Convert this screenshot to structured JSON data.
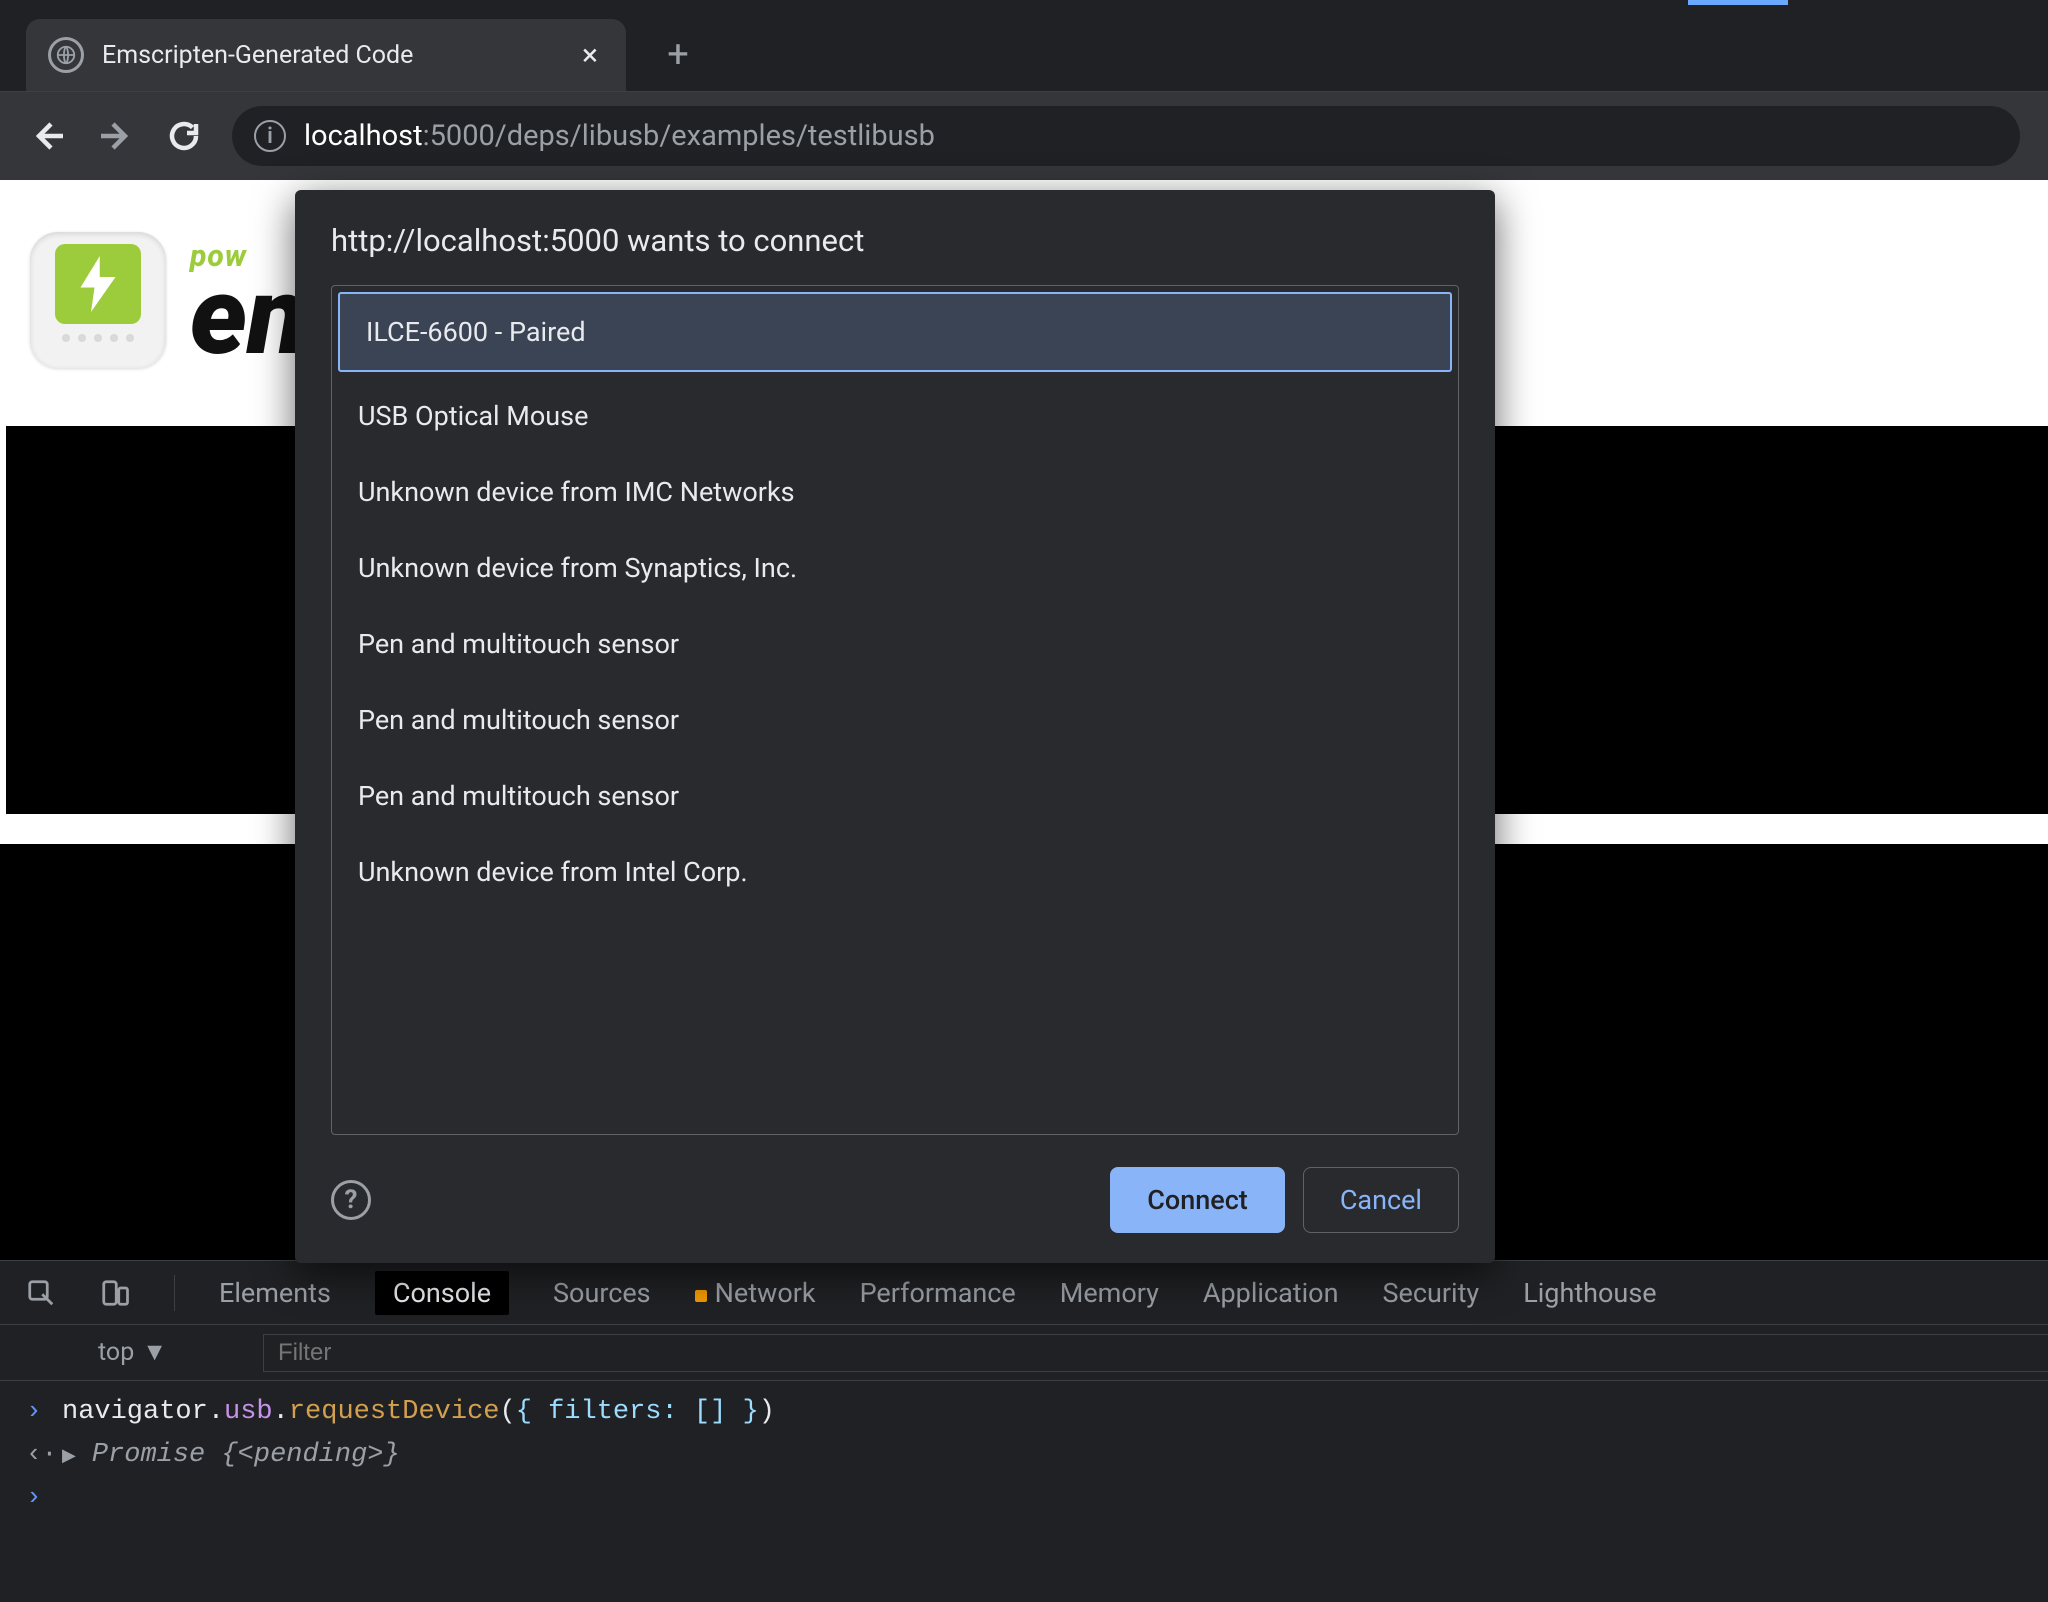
{
  "browser": {
    "tab_title": "Emscripten-Generated Code",
    "url_host": "localhost",
    "url_port_path": ":5000/deps/libusb/examples/testlibusb"
  },
  "page": {
    "brand_pow": "pow",
    "brand_en": "en"
  },
  "dialog": {
    "title": "http://localhost:5000 wants to connect",
    "devices": [
      "ILCE-6600 - Paired",
      "USB Optical Mouse",
      "Unknown device from IMC Networks",
      "Unknown device from Synaptics, Inc.",
      "Pen and multitouch sensor",
      "Pen and multitouch sensor",
      "Pen and multitouch sensor",
      "Unknown device from Intel Corp."
    ],
    "connect_label": "Connect",
    "cancel_label": "Cancel",
    "help_glyph": "?"
  },
  "devtools": {
    "tabs": {
      "elements": "Elements",
      "console": "Console",
      "sources": "Sources",
      "network": "Network",
      "performance": "Performance",
      "memory": "Memory",
      "application": "Application",
      "security": "Security",
      "lighthouse": "Lighthouse"
    },
    "toolbar": {
      "context": "top",
      "filter_placeholder": "Filter"
    },
    "console": {
      "input_tokens": {
        "navigator": "navigator",
        "usb": "usb",
        "requestDevice": "requestDevice",
        "args": "{ filters: [] }"
      },
      "output_tokens": {
        "arrow": "▶",
        "promise": "Promise",
        "open": " {",
        "pending": "<pending>",
        "close": "}"
      }
    }
  }
}
